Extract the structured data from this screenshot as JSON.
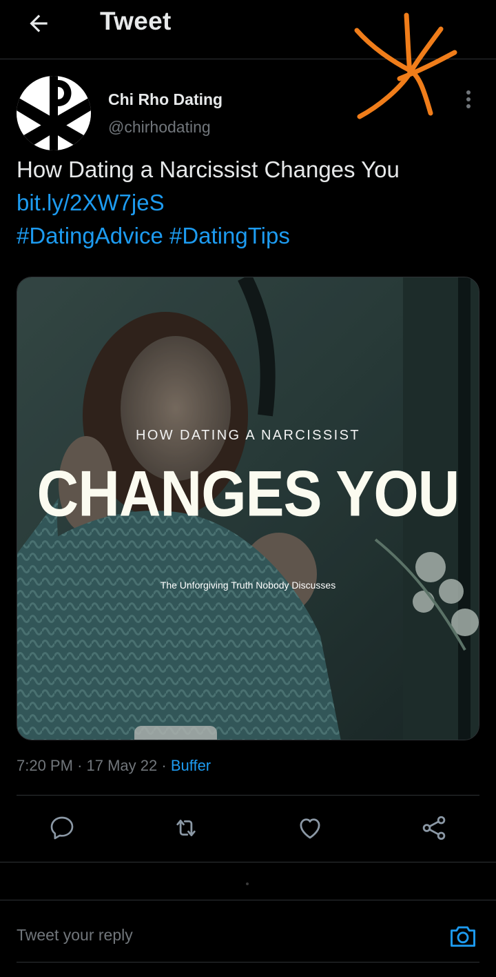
{
  "header": {
    "title": "Tweet",
    "back_icon": "arrow-left-icon"
  },
  "author": {
    "name": "Chi Rho Dating",
    "handle": "@chirhodating",
    "avatar_icon": "chi-rho-logo"
  },
  "tweet": {
    "text": "How Dating a Narcissist Changes You",
    "link": "bit.ly/2XW7jeS",
    "hashtags": [
      "#DatingAdvice",
      "#DatingTips"
    ]
  },
  "media": {
    "eyebrow": "HOW DATING A NARCISSIST",
    "headline": "CHANGES YOU",
    "subtitle": "The Unforgiving Truth Nobody Discusses"
  },
  "meta": {
    "time": "7:20 PM",
    "separator": "·",
    "date": "17 May 22",
    "source": "Buffer"
  },
  "actions": [
    {
      "name": "reply",
      "icon": "reply-icon"
    },
    {
      "name": "retweet",
      "icon": "retweet-icon"
    },
    {
      "name": "like",
      "icon": "heart-icon"
    },
    {
      "name": "share",
      "icon": "share-icon"
    }
  ],
  "reply": {
    "placeholder": "Tweet your reply",
    "camera_icon": "camera-icon"
  },
  "colors": {
    "background": "#000000",
    "text": "#e7e9ea",
    "secondary": "#71767b",
    "accent": "#1d9bf0",
    "annotation": "#f07d1a"
  }
}
